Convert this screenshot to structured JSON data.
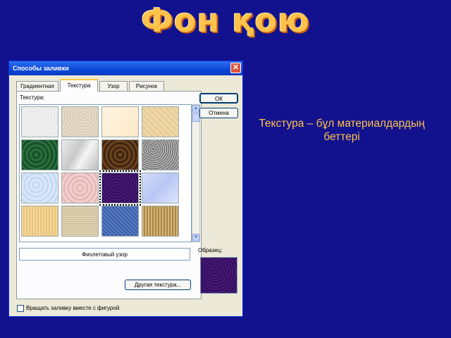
{
  "slide": {
    "title": "Фон қою",
    "caption": "Текстура – бұл материалдардың беттері"
  },
  "dialog": {
    "title": "Способы заливки",
    "close_glyph": "✕",
    "tabs": [
      {
        "label": "Градиентная"
      },
      {
        "label": "Текстура"
      },
      {
        "label": "Узор"
      },
      {
        "label": "Рисунок"
      }
    ],
    "active_tab": "Текстура",
    "texture_label": "Текстура:",
    "ok_label": "ОК",
    "cancel_label": "Отмена",
    "selected_texture_name": "Фиолетовый узор",
    "other_texture_label": "Другая текстура...",
    "sample_label": "Образец:",
    "rotate_checkbox_label": "Вращать заливку вместе с фигурой",
    "scroll_up_glyph": "▲",
    "scroll_down_glyph": "▼"
  },
  "colors": {
    "background": "#12128e",
    "title": "#ffc24a",
    "caption": "#ffc24a",
    "titlebar": "#0a48d6"
  }
}
